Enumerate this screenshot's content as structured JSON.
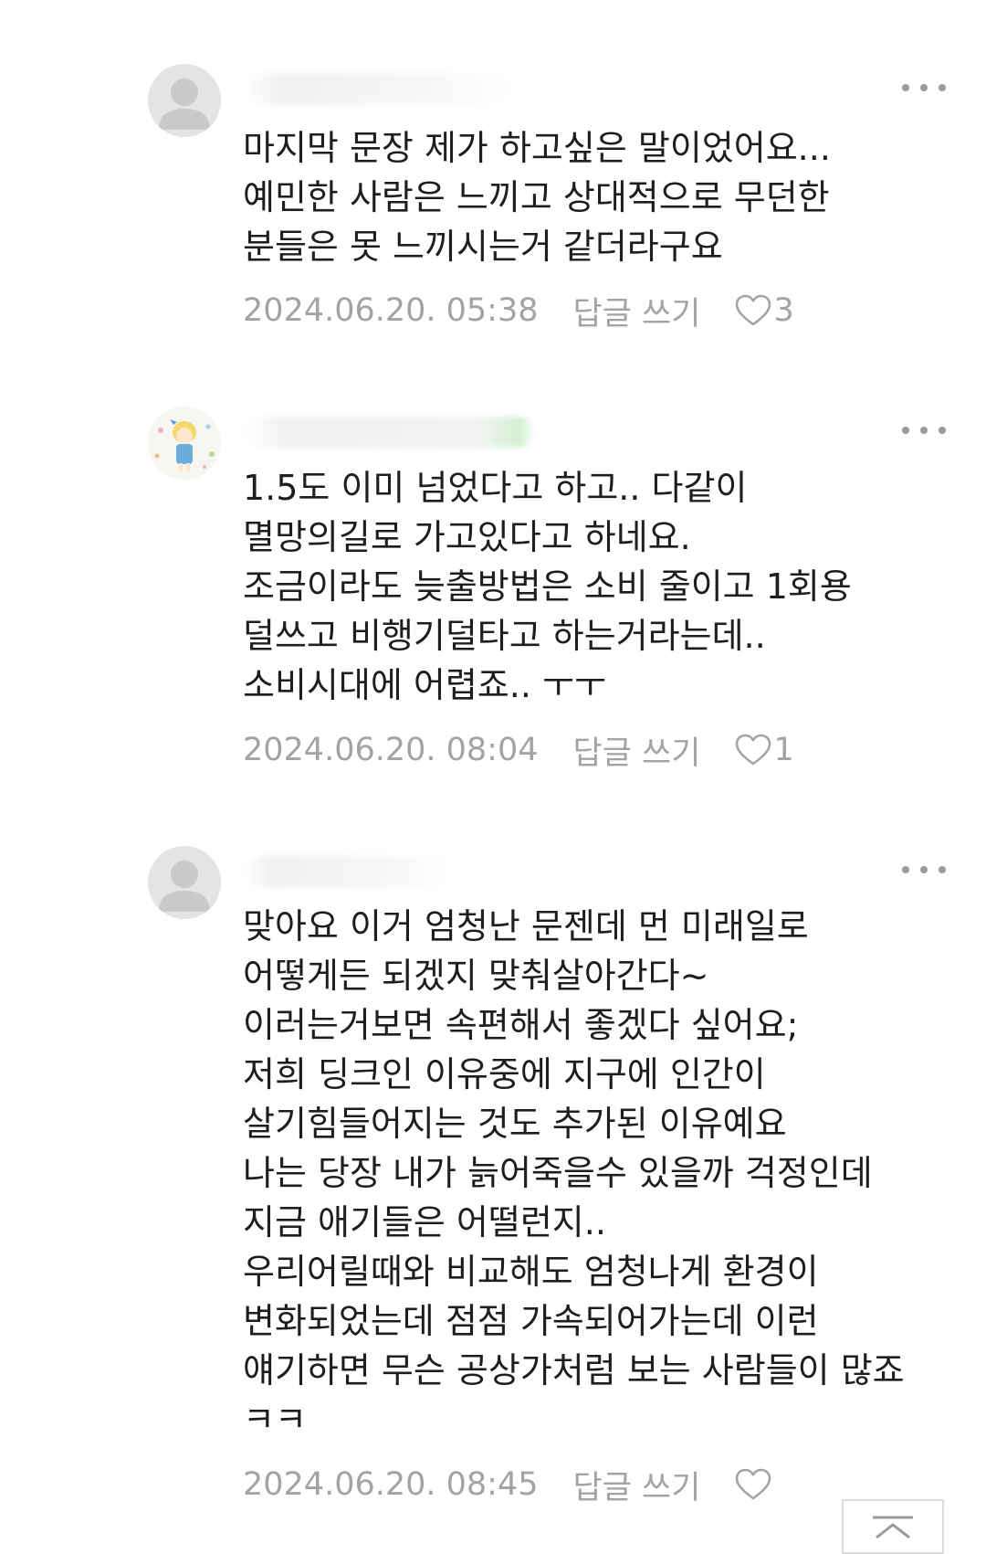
{
  "comments": [
    {
      "author": "",
      "avatar": "default-avatar-icon",
      "text": "마지막 문장 제가 하고싶은 말이었어요...\n예민한 사람은 느끼고 상대적으로 무던한\n분들은 못 느끼시는거 같더라구요",
      "timestamp": "2024.06.20. 05:38",
      "reply_label": "답글 쓰기",
      "likes": "3"
    },
    {
      "author": "",
      "avatar": "custom-profile-image",
      "text": "1.5도 이미 넘었다고 하고.. 다같이\n멸망의길로 가고있다고 하네요.\n조금이라도 늦출방법은 소비 줄이고 1회용\n덜쓰고 비행기덜타고 하는거라는데..\n소비시대에 어렵죠.. ㅜㅜ",
      "timestamp": "2024.06.20. 08:04",
      "reply_label": "답글 쓰기",
      "likes": "1"
    },
    {
      "author": "",
      "avatar": "default-avatar-icon",
      "text": "맞아요 이거 엄청난 문젠데 먼 미래일로\n어떻게든 되겠지 맞춰살아간다~\n이러는거보면 속편해서 좋겠다 싶어요;\n저희 딩크인 이유중에 지구에 인간이\n살기힘들어지는 것도 추가된 이유예요\n나는 당장 내가 늙어죽을수 있을까 걱정인데\n지금 애기들은 어떨런지..\n우리어릴때와 비교해도 엄청나게 환경이\n변화되었는데 점점 가속되어가는데 이런\n얘기하면 무슨 공상가처럼 보는 사람들이 많죠\nㅋㅋ",
      "timestamp": "2024.06.20. 08:45",
      "reply_label": "답글 쓰기",
      "likes": ""
    }
  ],
  "icons": {
    "more": "more-dots-icon",
    "like": "heart-outline-icon",
    "scroll_top": "arrow-up-to-top-icon"
  },
  "colors": {
    "text": "#1e1e1e",
    "meta": "#a3a3a3",
    "icon": "#9a9a9a"
  }
}
